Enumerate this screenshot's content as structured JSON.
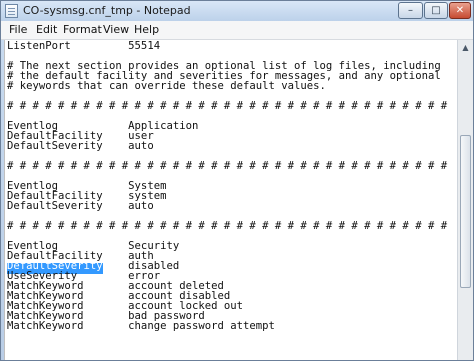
{
  "window": {
    "title": "CO-sysmsg.cnf_tmp - Notepad",
    "minimize_glyph": "–",
    "maximize_glyph": "□",
    "close_glyph": "✕",
    "close_color": "#c64b32"
  },
  "menu": {
    "file": "File",
    "edit": "Edit",
    "format": "Format",
    "view": "View",
    "help": "Help"
  },
  "editor": {
    "lines": [
      "ListenPort         55514",
      "",
      "# The next section provides an optional list of log files, including",
      "# the default facility and severities for messages, and any optional",
      "# keywords that can override these default values.",
      "",
      "# # # # # # # # # # # # # # # # # # # # # # # # # # # # # # # # # # #",
      "",
      "Eventlog           Application",
      "DefaultFacility    user",
      "DefaultSeverity    auto",
      "",
      "# # # # # # # # # # # # # # # # # # # # # # # # # # # # # # # # # # #",
      "",
      "Eventlog           System",
      "DefaultFacility    system",
      "DefaultSeverity    auto",
      "",
      "# # # # # # # # # # # # # # # # # # # # # # # # # # # # # # # # # # #",
      "",
      "Eventlog           Security",
      "DefaultFacility    auth",
      "DefaultSeverity    disabled",
      "UseSeverity        error",
      "MatchKeyword       account deleted",
      "MatchKeyword       account disabled",
      "MatchKeyword       account locked out",
      "MatchKeyword       bad password",
      "MatchKeyword       change password attempt"
    ],
    "selected_text": "DefaultSeverity",
    "selected_rest": "    disabled",
    "selection_color": "#3399ff"
  },
  "scrollbar": {
    "up_arrow": "▲"
  }
}
